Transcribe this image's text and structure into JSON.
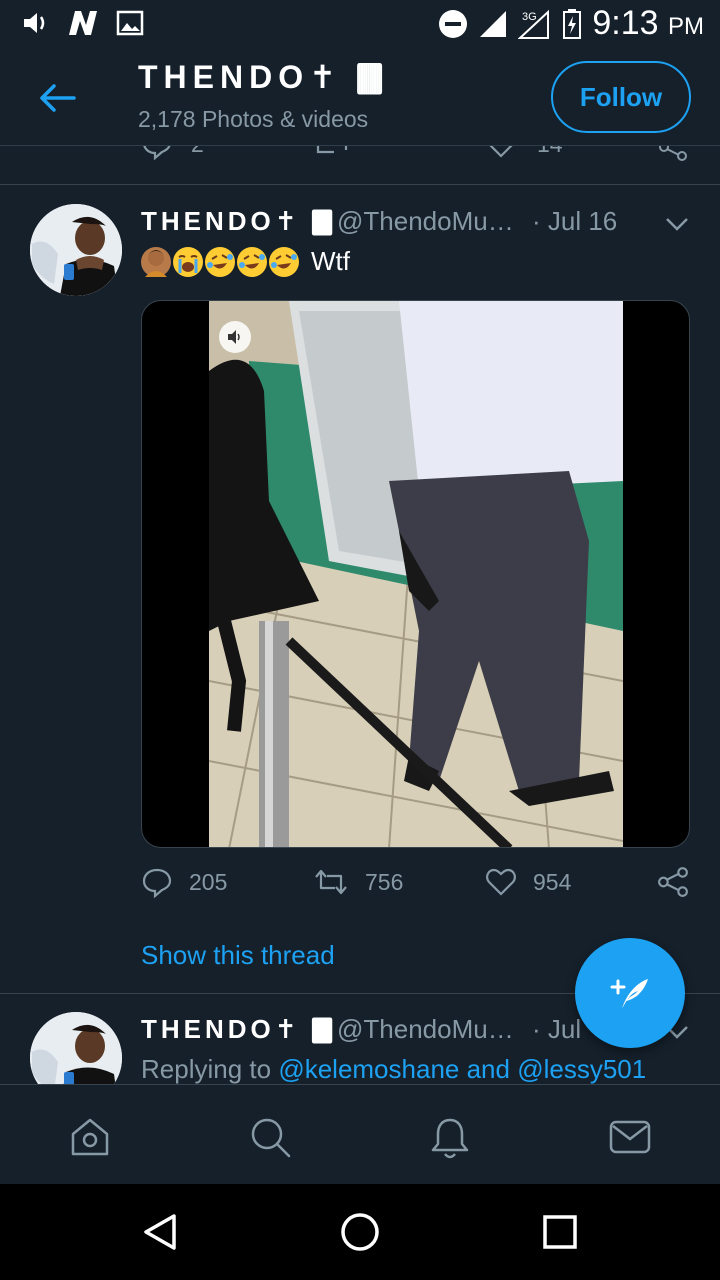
{
  "status_bar": {
    "time": "9:13",
    "ampm": "PM",
    "network": "3G"
  },
  "header": {
    "name": "THENDO✝︎ 🀫",
    "subtitle": "2,178 Photos & videos",
    "follow_label": "Follow"
  },
  "prev_tweet": {
    "reply_count": "2",
    "like_count": "14"
  },
  "tweet1": {
    "name": "THENDO✝︎ 🀫",
    "handle": "@ThendoMu…",
    "date": "· Jul 16",
    "text": "Wtf",
    "emojis": [
      "person-gesturing-no-emoji",
      "loudly-crying-face-emoji",
      "rolling-laughing-emoji",
      "rolling-laughing-emoji",
      "rolling-laughing-emoji"
    ],
    "replies": "205",
    "retweets": "756",
    "likes": "954",
    "show_thread": "Show this thread"
  },
  "tweet2": {
    "name": "THENDO✝︎ 🀫",
    "handle": "@ThendoMu…",
    "date": "· Jul",
    "replying_prefix": "Replying to ",
    "mention1": "@kelemoshane",
    "and_word": " and ",
    "mention2": "@lessy501"
  },
  "colors": {
    "background": "#15202b",
    "accent": "#1da1f2",
    "muted": "#8899a6",
    "divider": "#38444d"
  }
}
